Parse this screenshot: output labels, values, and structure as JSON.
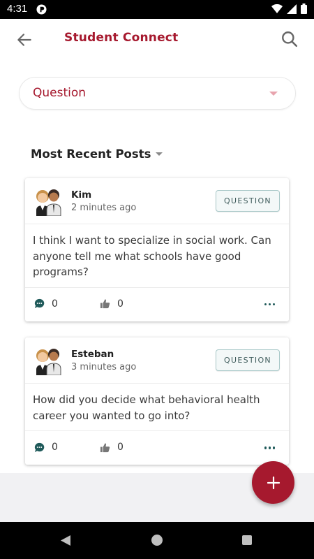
{
  "status_bar": {
    "time": "4:31"
  },
  "app_bar": {
    "title": "Student Connect"
  },
  "filter": {
    "selected": "Question"
  },
  "section": {
    "title": "Most Recent Posts"
  },
  "posts": [
    {
      "author": "Kim",
      "time": "2 minutes ago",
      "badge": "QUESTION",
      "body": "I think I want to specialize in social work. Can anyone tell me what schools have good programs?",
      "comments": "0",
      "likes": "0"
    },
    {
      "author": "Esteban",
      "time": "3 minutes ago",
      "badge": "QUESTION",
      "body": "How did you decide what behavioral health career you wanted to go into?",
      "comments": "0",
      "likes": "0"
    }
  ],
  "colors": {
    "brand": "#a6192e",
    "accent_teal": "#1f5a5a"
  },
  "icons": [
    "back-arrow-icon",
    "search-icon",
    "chevron-down-icon",
    "comment-icon",
    "thumbs-up-icon",
    "more-icon",
    "plus-icon"
  ]
}
